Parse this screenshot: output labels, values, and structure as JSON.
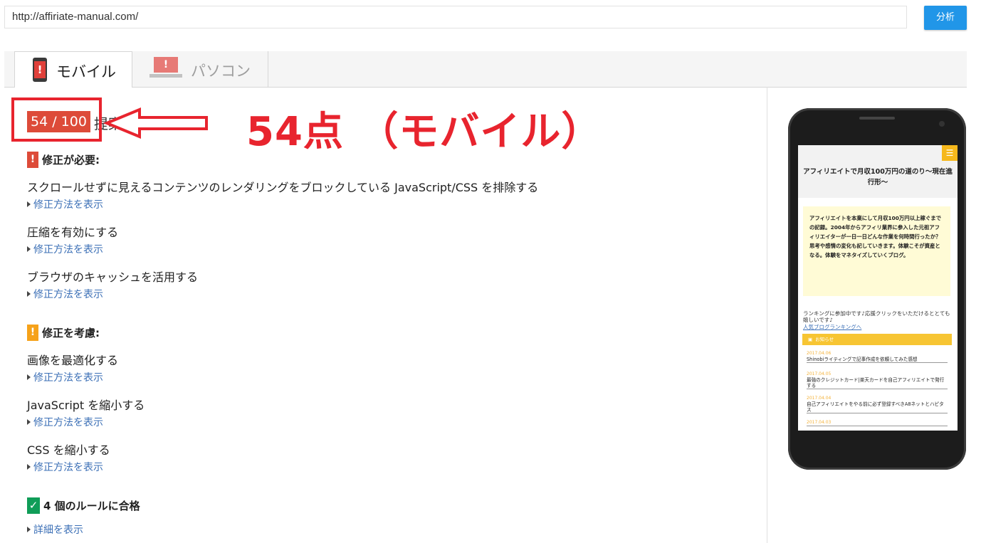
{
  "url_bar": {
    "value": "http://affiriate-manual.com/"
  },
  "analyze_button": "分析",
  "tabs": [
    {
      "label": "モバイル",
      "active": true
    },
    {
      "label": "パソコン",
      "active": false
    }
  ],
  "score": {
    "badge": "54 / 100",
    "summary_title": "提案の概要"
  },
  "annotation": {
    "text": "54点 （モバイル）",
    "color": "#e8242e"
  },
  "sections": {
    "must_fix": {
      "heading": "修正が必要:",
      "icon": "!",
      "rules": [
        {
          "title": "スクロールせずに見えるコンテンツのレンダリングをブロックしている JavaScript/CSS を排除する",
          "link": "修正方法を表示"
        },
        {
          "title": "圧縮を有効にする",
          "link": "修正方法を表示"
        },
        {
          "title": "ブラウザのキャッシュを活用する",
          "link": "修正方法を表示"
        }
      ]
    },
    "consider_fix": {
      "heading": "修正を考慮:",
      "icon": "!",
      "rules": [
        {
          "title": "画像を最適化する",
          "link": "修正方法を表示"
        },
        {
          "title": "JavaScript を縮小する",
          "link": "修正方法を表示"
        },
        {
          "title": "CSS を縮小する",
          "link": "修正方法を表示"
        }
      ]
    },
    "passed": {
      "heading": "4 個のルールに合格",
      "icon": "✓",
      "link": "詳細を表示"
    }
  },
  "phone_preview": {
    "site_title": "アフィリエイトで月収100万円の道のり〜現在進行形〜",
    "intro_text": "アフィリエイトを本業にして月収100万円以上稼ぐまでの記録。2004年からアフィリ業界に参入した元祖アフィリエイターが一日一日どんな作業を何時間行ったか？思考や感情の変化も記していきます。体験こそが資産となる。体験をマネタイズしていくブログ。",
    "ranking_text": "ランキングに参加中です♪応援クリックをいただけるととても嬉しいです♪",
    "ranking_link": "人気ブログランキングへ",
    "news_label": "お知らせ",
    "news": [
      {
        "date": "2017.04.06",
        "title": "Shinobiライティングで記事作成を依頼してみた感想"
      },
      {
        "date": "2017.04.05",
        "title": "最強のクレジットカード|楽天カードを自己アフィリエイトで発行する"
      },
      {
        "date": "2017.04.04",
        "title": "自己アフィリエイトをやる前に必ず登録すべきA8ネットとハピタス"
      },
      {
        "date": "2017.04.03",
        "title": ""
      }
    ]
  },
  "colors": {
    "error": "#dd4b39",
    "warning": "#f6a21a",
    "pass": "#109d58",
    "link": "#3b6fb6",
    "button": "#2196e8"
  }
}
